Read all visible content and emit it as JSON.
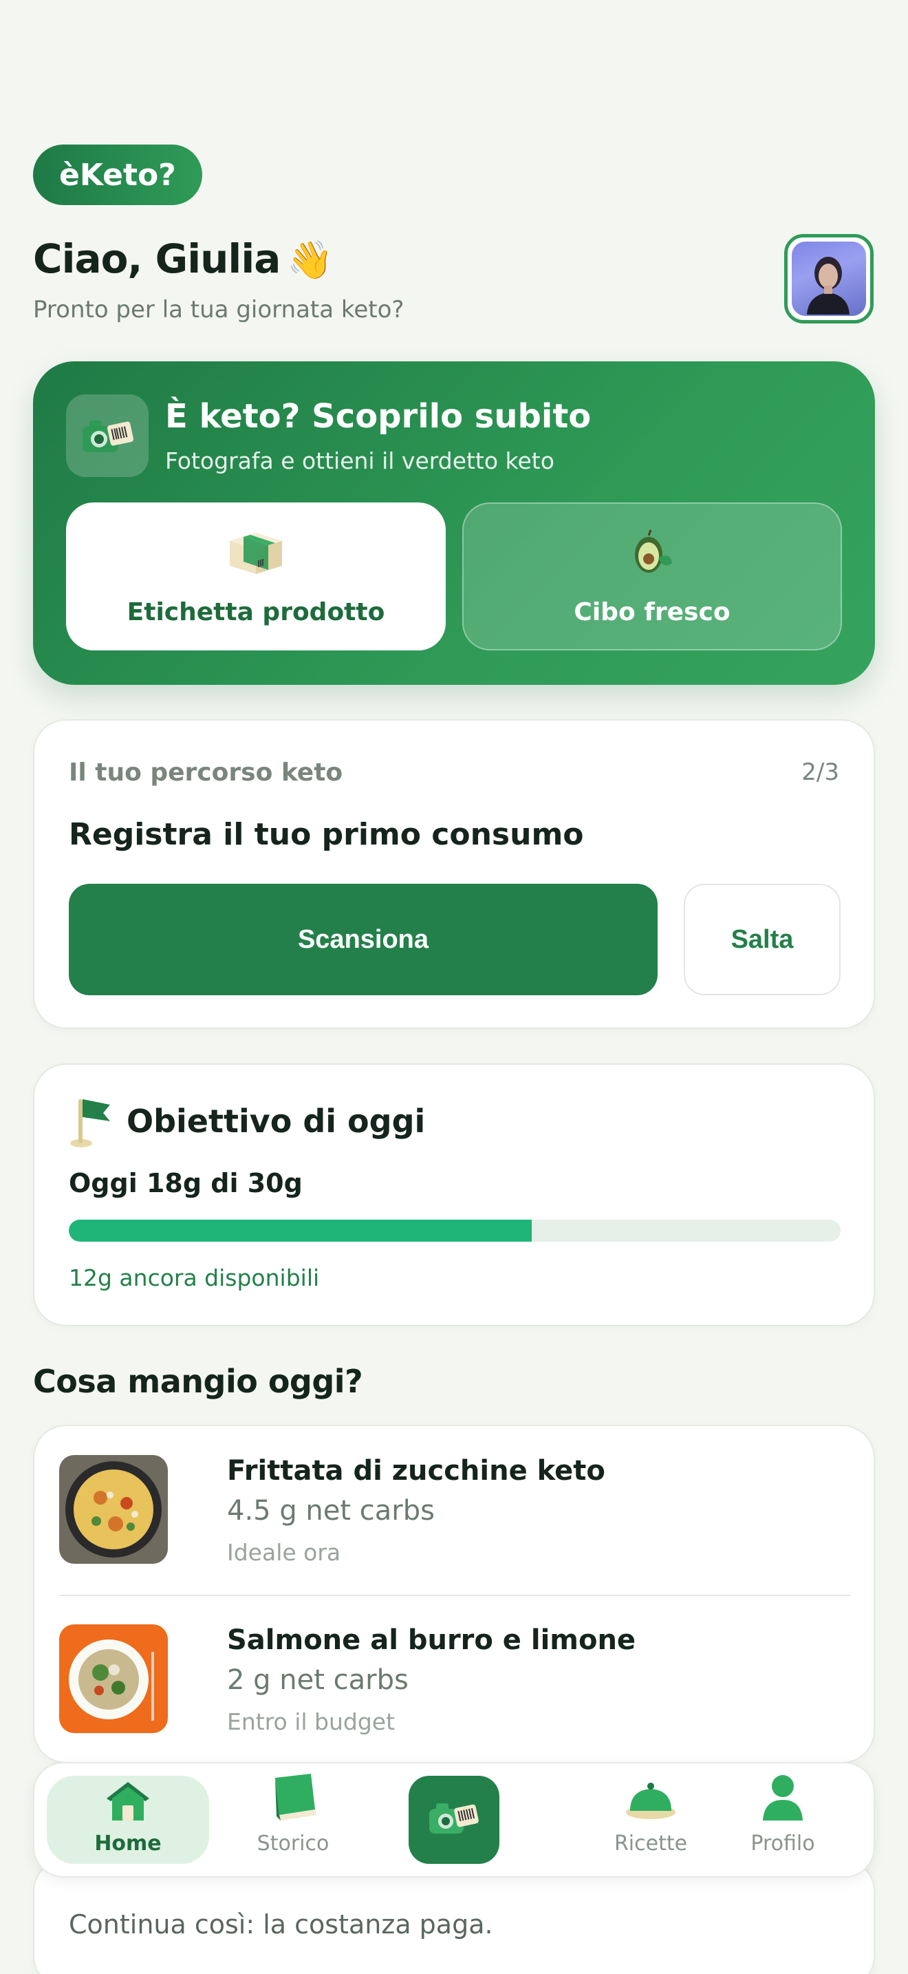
{
  "brand": {
    "name": "èKeto?"
  },
  "header": {
    "greeting": "Ciao, Giulia",
    "wave": "👋",
    "subtitle": "Pronto per la tua giornata keto?"
  },
  "hero": {
    "title": "È keto? Scoprilo subito",
    "subtitle": "Fotografa e ottieni il verdetto keto",
    "option_label": "Etichetta prodotto",
    "option_fresh": "Cibo fresco"
  },
  "journey": {
    "label": "Il tuo percorso keto",
    "step": "2/3",
    "title": "Registra il tuo primo consumo",
    "primary_button": "Scansiona",
    "secondary_button": "Salta"
  },
  "goal": {
    "title": "Obiettivo di oggi",
    "today": "Oggi 18g di 30g",
    "progress_fraction": 0.6,
    "remaining": "12g ancora disponibili"
  },
  "suggestions": {
    "title": "Cosa mangio oggi?",
    "items": [
      {
        "name": "Frittata di zucchine keto",
        "carbs": "4.5 g net carbs",
        "note": "Ideale ora"
      },
      {
        "name": "Salmone al burro e limone",
        "carbs": "2 g net carbs",
        "note": "Entro il budget"
      }
    ]
  },
  "motivation": {
    "text": "Continua così: la costanza paga."
  },
  "nav": {
    "items": [
      {
        "label": "Home",
        "icon": "house-icon"
      },
      {
        "label": "Storico",
        "icon": "book-icon"
      },
      {
        "label": "",
        "icon": "camera-barcode-icon"
      },
      {
        "label": "Ricette",
        "icon": "cloche-icon"
      },
      {
        "label": "Profilo",
        "icon": "person-icon"
      }
    ]
  },
  "colors": {
    "primary": "#23804a",
    "accent_progress": "#1fb578",
    "background": "#f4f6f2"
  }
}
